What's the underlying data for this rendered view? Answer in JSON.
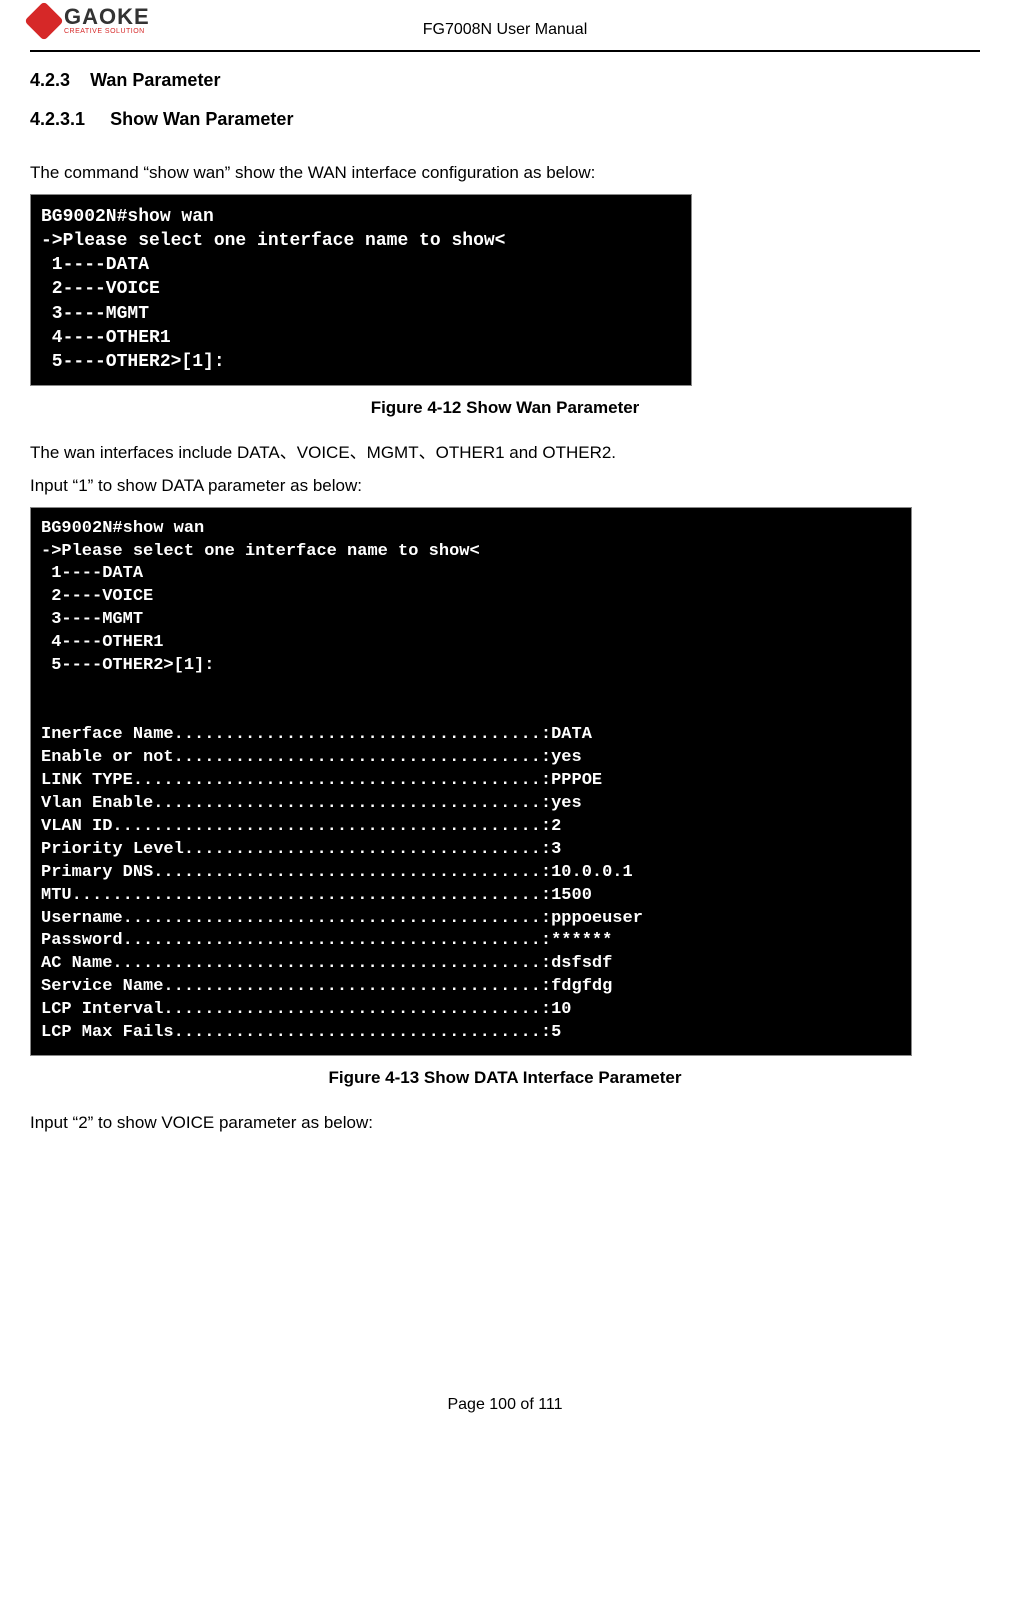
{
  "header": {
    "logo_brand": "GAOKE",
    "logo_tag": "CREATIVE SOLUTION",
    "doc_title": "FG7008N User Manual"
  },
  "section": {
    "num_h3": "4.2.3",
    "title_h3": "Wan Parameter",
    "num_h4": "4.2.3.1",
    "title_h4": "Show Wan Parameter"
  },
  "body": {
    "p1": "The command “show wan” show the WAN interface configuration as below:",
    "p2": "The wan interfaces include DATA、VOICE、MGMT、OTHER1 and OTHER2.",
    "p3": "Input “1” to show DATA parameter as below:",
    "p4": "Input “2” to show VOICE parameter as below:"
  },
  "terminal1": "BG9002N#show wan\n->Please select one interface name to show<\n 1----DATA\n 2----VOICE\n 3----MGMT\n 4----OTHER1\n 5----OTHER2>[1]:",
  "caption1": "Figure 4-12  Show Wan Parameter",
  "terminal2": "BG9002N#show wan\n->Please select one interface name to show<\n 1----DATA\n 2----VOICE\n 3----MGMT\n 4----OTHER1\n 5----OTHER2>[1]:\n\n\nInerface Name....................................:DATA\nEnable or not....................................:yes\nLINK TYPE........................................:PPPOE\nVlan Enable......................................:yes\nVLAN ID..........................................:2\nPriority Level...................................:3\nPrimary DNS......................................:10.0.0.1\nMTU..............................................:1500\nUsername.........................................:pppoeuser\nPassword.........................................:******\nAC Name..........................................:dsfsdf\nService Name.....................................:fdgfdg\nLCP Interval.....................................:10\nLCP Max Fails....................................:5",
  "caption2": "Figure 4-13  Show DATA Interface Parameter",
  "footer": "Page 100 of 111"
}
